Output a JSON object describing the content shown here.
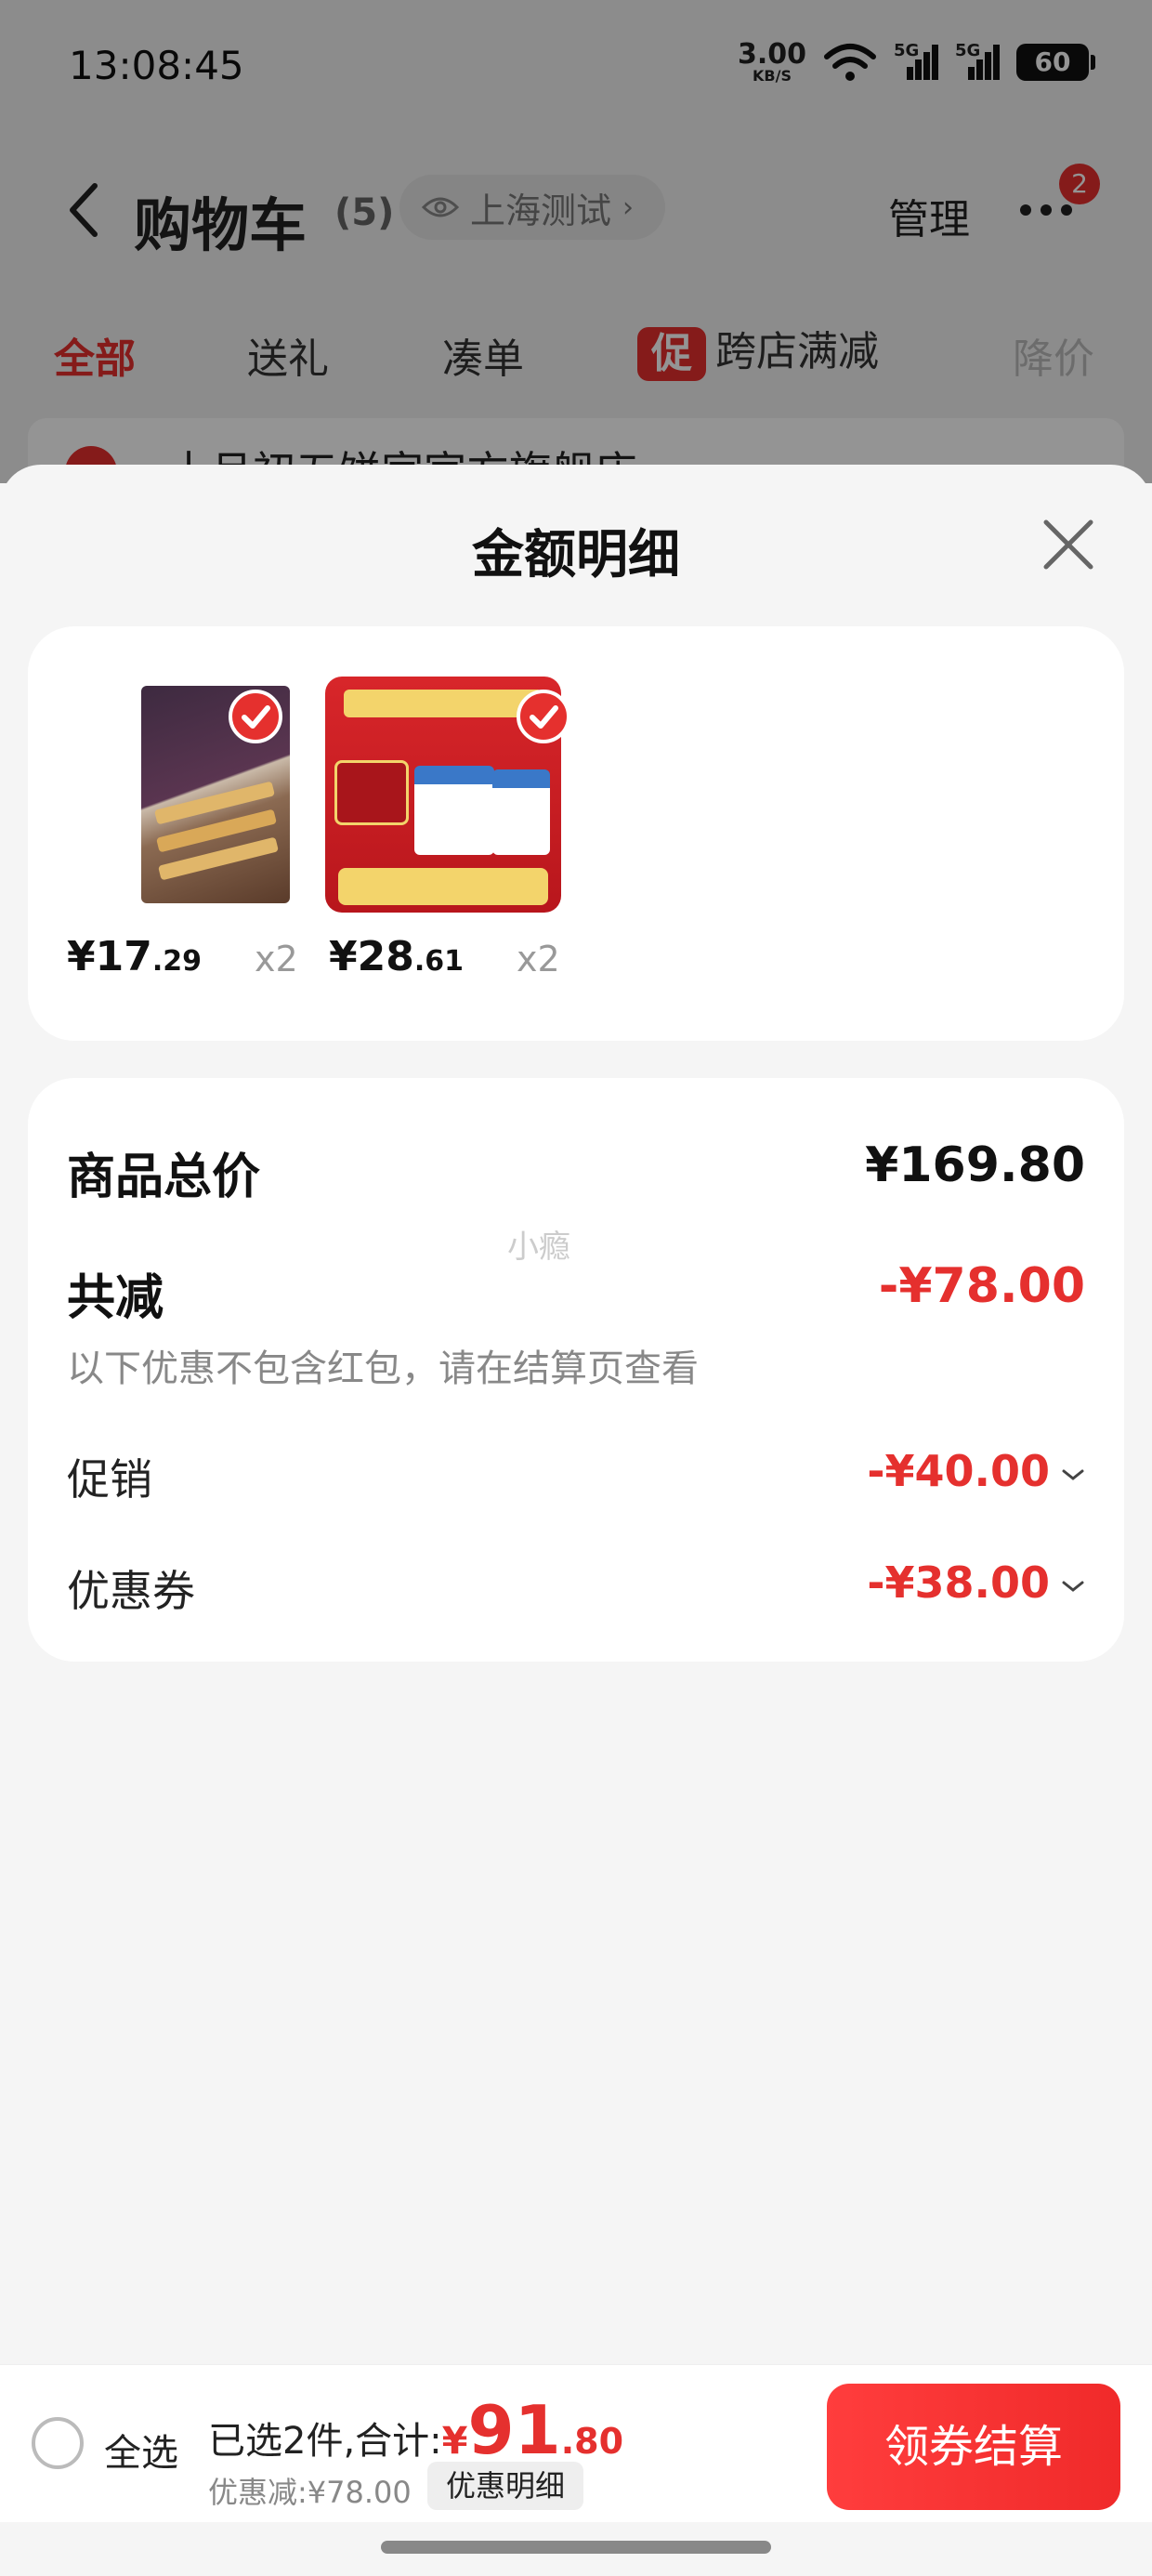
{
  "status_bar": {
    "time": "13:08:45",
    "net_speed": "3.00",
    "net_unit": "KB/S",
    "sig1": "5G",
    "sig2": "5G",
    "battery": "60"
  },
  "nav": {
    "title": "购物车",
    "count": "(5)",
    "location": "上海测试",
    "manage": "管理",
    "badge": "2"
  },
  "tabs": [
    {
      "label": "全部",
      "active": true
    },
    {
      "label": "送礼"
    },
    {
      "label": "凑单"
    },
    {
      "label": "跨店满减",
      "tag": "促"
    },
    {
      "label": "降价"
    }
  ],
  "shop": {
    "name": "十月初五饼家官方旗舰店"
  },
  "sheet": {
    "title": "金额明细"
  },
  "products": [
    {
      "price_int": "¥17",
      "price_dec": ".29",
      "qty": "x2",
      "image": "almond-cookie-box"
    },
    {
      "price_int": "¥28",
      "price_dec": ".61",
      "qty": "x2",
      "image": "yili-pure-milk-box"
    }
  ],
  "summary": {
    "total_label": "商品总价",
    "total_value": "¥169.80",
    "reduce_label": "共减",
    "reduce_value": "-¥78.00",
    "note": "以下优惠不包含红包，请在结算页查看",
    "promo_label": "促销",
    "promo_value": "-¥40.00",
    "coupon_label": "优惠券",
    "coupon_value": "-¥38.00",
    "watermark": "小瘾"
  },
  "bottom": {
    "select_all": "全选",
    "selected_text": "已选2件,合计:",
    "yen": "¥",
    "total_int": "91",
    "total_dec": ".80",
    "discount_text": "优惠减:¥78.00",
    "detail_button": "优惠明细",
    "checkout": "领券结算"
  },
  "colors": {
    "accent": "#e5302e"
  }
}
